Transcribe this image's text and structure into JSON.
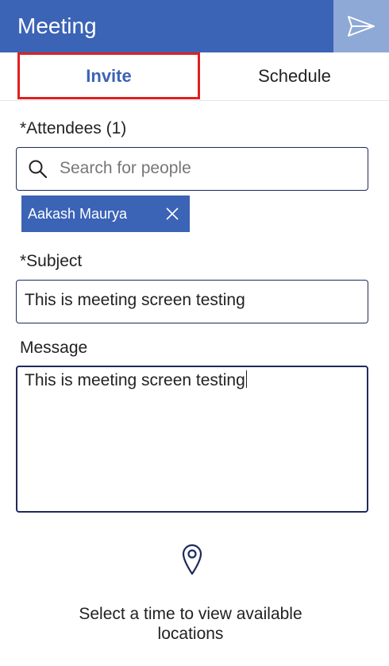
{
  "header": {
    "title": "Meeting",
    "send_icon": "send-icon"
  },
  "tabs": [
    {
      "label": "Invite",
      "selected": true
    },
    {
      "label": "Schedule",
      "selected": false
    }
  ],
  "attendees": {
    "label": "*Attendees (1)",
    "search_placeholder": "Search for people",
    "chips": [
      {
        "name": "Aakash Maurya"
      }
    ]
  },
  "subject": {
    "label": "*Subject",
    "value": "This is meeting screen testing"
  },
  "message": {
    "label": "Message",
    "value": "This is meeting screen testing"
  },
  "location": {
    "icon": "map-pin-icon",
    "hint_line1": "Select a time to view available",
    "hint_line2": "locations"
  },
  "colors": {
    "accent": "#3b63b6",
    "send_button_bg": "#8ea9d6",
    "highlight_border": "#e02020",
    "field_border": "#1f2a5c"
  }
}
